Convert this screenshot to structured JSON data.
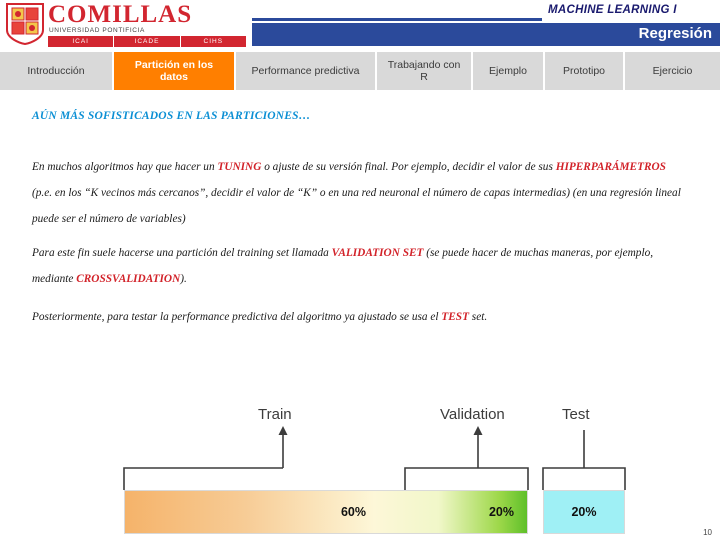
{
  "header": {
    "logo_word": "COMILLAS",
    "logo_sub": "UNIVERSIDAD PONTIFICIA",
    "logo_schools": [
      "ICAI",
      "ICADE",
      "CIHS"
    ],
    "course_title": "MACHINE LEARNING I",
    "section_label": "Regresión"
  },
  "nav": {
    "tabs": [
      {
        "label": "Introducción",
        "active": false
      },
      {
        "label": "Partición en los datos",
        "active": true
      },
      {
        "label": "Performance predictiva",
        "active": false
      },
      {
        "label": "Trabajando con R",
        "active": false
      },
      {
        "label": "Ejemplo",
        "active": false
      },
      {
        "label": "Prototipo",
        "active": false
      },
      {
        "label": "Ejercicio",
        "active": false
      }
    ]
  },
  "main": {
    "section_title": "AÚN MÁS SOFISTICADOS EN LAS PARTICIONES…",
    "paragraph_1": {
      "part_1": "En muchos algoritmos hay que hacer un ",
      "highlight_1": "TUNING",
      "part_2": " o ajuste de su versión final. Por ejemplo, decidir el valor de sus ",
      "highlight_2": "HIPERPARÁMETROS",
      "part_3": " (p.e. en los “K vecinos más cercanos”, decidir el valor de “K” o en una red neuronal el número de capas intermedias) (en una regresión lineal puede ser el número de variables)"
    },
    "paragraph_2": {
      "part_1": "Para este fin suele hacerse una partición del training set llamada ",
      "highlight_1": "VALIDATION SET",
      "part_2": " (se puede hacer de muchas maneras, por ejemplo, mediante ",
      "highlight_2": "CROSSVALIDATION",
      "part_3": ")."
    },
    "paragraph_3": {
      "part_1": "Posteriormente, para testar la performance predictiva del algoritmo ya ajustado se usa el ",
      "highlight_1": "TEST",
      "part_2": " set."
    }
  },
  "diagram": {
    "labels": {
      "train": "Train",
      "validation": "Validation",
      "test": "Test"
    },
    "bars": [
      {
        "name": "train",
        "percent": "60%"
      },
      {
        "name": "validation",
        "percent": "20%"
      },
      {
        "name": "test",
        "percent": "20%"
      }
    ]
  },
  "footer": {
    "page_number": "10"
  },
  "colors": {
    "brand_red": "#d2232a",
    "nav_active": "#ff7f00",
    "header_blue": "#2b4a9b",
    "section_title": "#0b8fd4",
    "test_bar": "#9ff0f5"
  }
}
